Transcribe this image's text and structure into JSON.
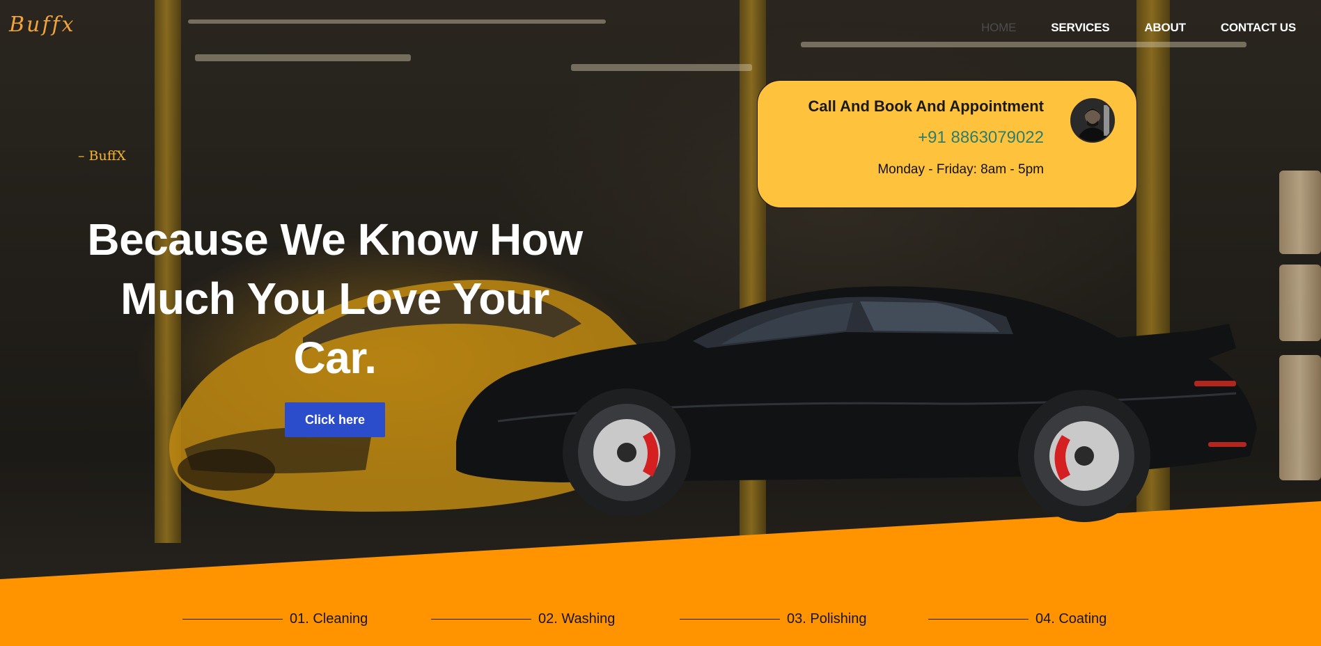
{
  "brand": {
    "logo_text": "Buffx"
  },
  "nav": {
    "items": [
      {
        "label": "HOME",
        "active": true
      },
      {
        "label": "SERVICES",
        "active": false
      },
      {
        "label": "ABOUT",
        "active": false
      },
      {
        "label": "CONTACT US",
        "active": false
      }
    ]
  },
  "hero": {
    "tagline": "– BuffX",
    "headline_line1": "Because We Know How",
    "headline_line2": "Much You Love Your",
    "headline_line3": "Car.",
    "cta_label": "Click here"
  },
  "appointment_card": {
    "title": "Call And Book And Appointment",
    "phone": "+91 8863079022",
    "hours": "Monday - Friday: 8am - 5pm",
    "avatar_icon": "person-avatar"
  },
  "services": [
    {
      "label": "01. Cleaning"
    },
    {
      "label": "02. Washing"
    },
    {
      "label": "03. Polishing"
    },
    {
      "label": "04. Coating"
    }
  ],
  "colors": {
    "accent_orange": "#ff9400",
    "card_yellow": "#ffc23c",
    "cta_blue": "#2b4ccb",
    "phone_green": "#2e7d6a",
    "logo_orange": "#f1a53a"
  }
}
